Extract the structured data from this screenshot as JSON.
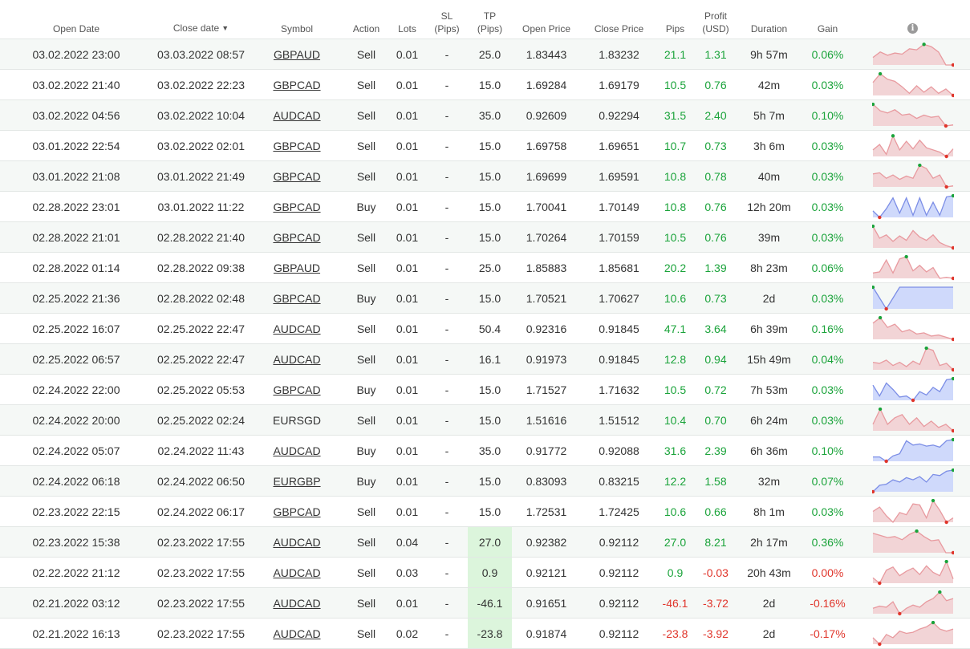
{
  "headers": {
    "open_date": "Open Date",
    "close_date": "Close date",
    "close_sort_icon": "▼",
    "symbol": "Symbol",
    "action": "Action",
    "lots": "Lots",
    "sl_line1": "SL",
    "sl_line2": "(Pips)",
    "tp_line1": "TP",
    "tp_line2": "(Pips)",
    "open_price": "Open Price",
    "close_price": "Close Price",
    "pips": "Pips",
    "profit_line1": "Profit",
    "profit_line2": "(USD)",
    "duration": "Duration",
    "gain": "Gain",
    "info_icon": "i"
  },
  "colors": {
    "positive": "#1aa33a",
    "negative": "#e0352b",
    "sell_fill": "#f2d4d6",
    "sell_stroke": "#e89a9f",
    "buy_fill": "#cfd9fb",
    "buy_stroke": "#7c8ee6",
    "tp_highlight": "#dcf5dc"
  },
  "rows": [
    {
      "open": "03.02.2022 23:00",
      "close": "03.03.2022 08:57",
      "symbol": "GBPAUD",
      "link": true,
      "action": "Sell",
      "lots": "0.01",
      "sl": "-",
      "tp": "25.0",
      "tp_hl": false,
      "open_price": "1.83443",
      "close_price": "1.83232",
      "pips": "21.1",
      "profit": "1.31",
      "duration": "9h 57m",
      "gain": "0.06%",
      "neg": false,
      "spark": [
        0.35,
        0.6,
        0.45,
        0.55,
        0.5,
        0.75,
        0.7,
        0.95,
        0.85,
        0.6,
        0.0,
        0.0
      ]
    },
    {
      "open": "03.02.2022 21:40",
      "close": "03.02.2022 22:23",
      "symbol": "GBPCAD",
      "link": true,
      "action": "Sell",
      "lots": "0.01",
      "sl": "-",
      "tp": "15.0",
      "tp_hl": false,
      "open_price": "1.69284",
      "close_price": "1.69179",
      "pips": "10.5",
      "profit": "0.76",
      "duration": "42m",
      "gain": "0.03%",
      "neg": false,
      "spark": [
        0.6,
        1.0,
        0.75,
        0.65,
        0.4,
        0.1,
        0.45,
        0.15,
        0.4,
        0.1,
        0.3,
        0.0
      ]
    },
    {
      "open": "03.02.2022 04:56",
      "close": "03.02.2022 10:04",
      "symbol": "AUDCAD",
      "link": true,
      "action": "Sell",
      "lots": "0.01",
      "sl": "-",
      "tp": "35.0",
      "tp_hl": false,
      "open_price": "0.92609",
      "close_price": "0.92294",
      "pips": "31.5",
      "profit": "2.40",
      "duration": "5h 7m",
      "gain": "0.10%",
      "neg": false,
      "spark": [
        1.0,
        0.7,
        0.6,
        0.75,
        0.5,
        0.55,
        0.35,
        0.5,
        0.4,
        0.45,
        0.0,
        0.05
      ]
    },
    {
      "open": "03.01.2022 22:54",
      "close": "03.02.2022 02:01",
      "symbol": "GBPCAD",
      "link": true,
      "action": "Sell",
      "lots": "0.01",
      "sl": "-",
      "tp": "15.0",
      "tp_hl": false,
      "open_price": "1.69758",
      "close_price": "1.69651",
      "pips": "10.7",
      "profit": "0.73",
      "duration": "3h 6m",
      "gain": "0.03%",
      "neg": false,
      "spark": [
        0.3,
        0.55,
        0.1,
        0.95,
        0.3,
        0.7,
        0.35,
        0.75,
        0.4,
        0.3,
        0.2,
        0.0,
        0.35
      ]
    },
    {
      "open": "03.01.2022 21:08",
      "close": "03.01.2022 21:49",
      "symbol": "GBPCAD",
      "link": true,
      "action": "Sell",
      "lots": "0.01",
      "sl": "-",
      "tp": "15.0",
      "tp_hl": false,
      "open_price": "1.69699",
      "close_price": "1.69591",
      "pips": "10.8",
      "profit": "0.78",
      "duration": "40m",
      "gain": "0.03%",
      "neg": false,
      "spark": [
        0.6,
        0.65,
        0.4,
        0.55,
        0.35,
        0.5,
        0.4,
        1.0,
        0.85,
        0.4,
        0.55,
        0.0,
        0.05
      ]
    },
    {
      "open": "02.28.2022 23:01",
      "close": "03.01.2022 11:22",
      "symbol": "GBPCAD",
      "link": true,
      "action": "Buy",
      "lots": "0.01",
      "sl": "-",
      "tp": "15.0",
      "tp_hl": false,
      "open_price": "1.70041",
      "close_price": "1.70149",
      "pips": "10.8",
      "profit": "0.76",
      "duration": "12h 20m",
      "gain": "0.03%",
      "neg": false,
      "spark": [
        0.3,
        0.0,
        0.4,
        0.9,
        0.2,
        0.9,
        0.1,
        0.9,
        0.1,
        0.7,
        0.1,
        0.95,
        1.0
      ]
    },
    {
      "open": "02.28.2022 21:01",
      "close": "02.28.2022 21:40",
      "symbol": "GBPCAD",
      "link": true,
      "action": "Sell",
      "lots": "0.01",
      "sl": "-",
      "tp": "15.0",
      "tp_hl": false,
      "open_price": "1.70264",
      "close_price": "1.70159",
      "pips": "10.5",
      "profit": "0.76",
      "duration": "39m",
      "gain": "0.03%",
      "neg": false,
      "spark": [
        1.0,
        0.45,
        0.6,
        0.3,
        0.55,
        0.35,
        0.8,
        0.5,
        0.35,
        0.6,
        0.25,
        0.1,
        0.0
      ]
    },
    {
      "open": "02.28.2022 01:14",
      "close": "02.28.2022 09:38",
      "symbol": "GBPAUD",
      "link": true,
      "action": "Sell",
      "lots": "0.01",
      "sl": "-",
      "tp": "25.0",
      "tp_hl": false,
      "open_price": "1.85883",
      "close_price": "1.85681",
      "pips": "20.2",
      "profit": "1.39",
      "duration": "8h 23m",
      "gain": "0.06%",
      "neg": false,
      "spark": [
        0.25,
        0.3,
        0.85,
        0.25,
        0.9,
        1.0,
        0.35,
        0.6,
        0.3,
        0.5,
        0.0,
        0.05,
        0.0
      ]
    },
    {
      "open": "02.25.2022 21:36",
      "close": "02.28.2022 02:48",
      "symbol": "GBPCAD",
      "link": true,
      "action": "Buy",
      "lots": "0.01",
      "sl": "-",
      "tp": "15.0",
      "tp_hl": false,
      "open_price": "1.70521",
      "close_price": "1.70627",
      "pips": "10.6",
      "profit": "0.73",
      "duration": "2d",
      "gain": "0.03%",
      "neg": false,
      "spark": [
        1.0,
        0.0,
        1.0,
        1.0,
        1.0,
        1.0,
        1.0
      ]
    },
    {
      "open": "02.25.2022 16:07",
      "close": "02.25.2022 22:47",
      "symbol": "AUDCAD",
      "link": true,
      "action": "Sell",
      "lots": "0.01",
      "sl": "-",
      "tp": "50.4",
      "tp_hl": false,
      "open_price": "0.92316",
      "close_price": "0.91845",
      "pips": "47.1",
      "profit": "3.64",
      "duration": "6h 39m",
      "gain": "0.16%",
      "neg": false,
      "spark": [
        0.75,
        1.0,
        0.55,
        0.7,
        0.35,
        0.45,
        0.25,
        0.3,
        0.15,
        0.2,
        0.1,
        0.0
      ]
    },
    {
      "open": "02.25.2022 06:57",
      "close": "02.25.2022 22:47",
      "symbol": "AUDCAD",
      "link": true,
      "action": "Sell",
      "lots": "0.01",
      "sl": "-",
      "tp": "16.1",
      "tp_hl": false,
      "open_price": "0.91973",
      "close_price": "0.91845",
      "pips": "12.8",
      "profit": "0.94",
      "duration": "15h 49m",
      "gain": "0.04%",
      "neg": false,
      "spark": [
        0.35,
        0.3,
        0.45,
        0.2,
        0.35,
        0.15,
        0.4,
        0.25,
        1.0,
        0.9,
        0.2,
        0.3,
        0.0
      ]
    },
    {
      "open": "02.24.2022 22:00",
      "close": "02.25.2022 05:53",
      "symbol": "GBPCAD",
      "link": true,
      "action": "Buy",
      "lots": "0.01",
      "sl": "-",
      "tp": "15.0",
      "tp_hl": false,
      "open_price": "1.71527",
      "close_price": "1.71632",
      "pips": "10.5",
      "profit": "0.72",
      "duration": "7h 53m",
      "gain": "0.03%",
      "neg": false,
      "spark": [
        0.7,
        0.2,
        0.8,
        0.5,
        0.15,
        0.2,
        0.0,
        0.4,
        0.25,
        0.6,
        0.4,
        0.95,
        1.0
      ]
    },
    {
      "open": "02.24.2022 20:00",
      "close": "02.25.2022 02:24",
      "symbol": "EURSGD",
      "link": false,
      "action": "Sell",
      "lots": "0.01",
      "sl": "-",
      "tp": "15.0",
      "tp_hl": false,
      "open_price": "1.51616",
      "close_price": "1.51512",
      "pips": "10.4",
      "profit": "0.70",
      "duration": "6h 24m",
      "gain": "0.03%",
      "neg": false,
      "spark": [
        0.3,
        1.0,
        0.3,
        0.6,
        0.75,
        0.3,
        0.6,
        0.2,
        0.45,
        0.15,
        0.3,
        0.0
      ]
    },
    {
      "open": "02.24.2022 05:07",
      "close": "02.24.2022 11:43",
      "symbol": "AUDCAD",
      "link": true,
      "action": "Buy",
      "lots": "0.01",
      "sl": "-",
      "tp": "35.0",
      "tp_hl": false,
      "open_price": "0.91772",
      "close_price": "0.92088",
      "pips": "31.6",
      "profit": "2.39",
      "duration": "6h 36m",
      "gain": "0.10%",
      "neg": false,
      "spark": [
        0.2,
        0.2,
        0.0,
        0.25,
        0.35,
        0.95,
        0.75,
        0.8,
        0.7,
        0.75,
        0.65,
        0.95,
        1.0
      ]
    },
    {
      "open": "02.24.2022 06:18",
      "close": "02.24.2022 06:50",
      "symbol": "EURGBP",
      "link": true,
      "action": "Buy",
      "lots": "0.01",
      "sl": "-",
      "tp": "15.0",
      "tp_hl": false,
      "open_price": "0.83093",
      "close_price": "0.83215",
      "pips": "12.2",
      "profit": "1.58",
      "duration": "32m",
      "gain": "0.07%",
      "neg": false,
      "spark": [
        0.0,
        0.3,
        0.35,
        0.55,
        0.45,
        0.65,
        0.55,
        0.7,
        0.45,
        0.8,
        0.75,
        0.95,
        1.0
      ]
    },
    {
      "open": "02.23.2022 22:15",
      "close": "02.24.2022 06:17",
      "symbol": "GBPCAD",
      "link": true,
      "action": "Sell",
      "lots": "0.01",
      "sl": "-",
      "tp": "15.0",
      "tp_hl": false,
      "open_price": "1.72531",
      "close_price": "1.72425",
      "pips": "10.6",
      "profit": "0.66",
      "duration": "8h 1m",
      "gain": "0.03%",
      "neg": false,
      "spark": [
        0.5,
        0.7,
        0.3,
        0.0,
        0.45,
        0.35,
        0.85,
        0.8,
        0.2,
        1.0,
        0.55,
        0.0,
        0.2
      ]
    },
    {
      "open": "02.23.2022 15:38",
      "close": "02.23.2022 17:55",
      "symbol": "AUDCAD",
      "link": true,
      "action": "Sell",
      "lots": "0.04",
      "sl": "-",
      "tp": "27.0",
      "tp_hl": true,
      "open_price": "0.92382",
      "close_price": "0.92112",
      "pips": "27.0",
      "profit": "8.21",
      "duration": "2h 17m",
      "gain": "0.36%",
      "neg": false,
      "spark": [
        0.9,
        0.8,
        0.7,
        0.75,
        0.6,
        0.85,
        1.0,
        0.75,
        0.55,
        0.6,
        0.0,
        0.0
      ]
    },
    {
      "open": "02.22.2022 21:12",
      "close": "02.23.2022 17:55",
      "symbol": "AUDCAD",
      "link": true,
      "action": "Sell",
      "lots": "0.03",
      "sl": "-",
      "tp": "0.9",
      "tp_hl": true,
      "open_price": "0.92121",
      "close_price": "0.92112",
      "pips": "0.9",
      "profit": "-0.03",
      "duration": "20h 43m",
      "gain": "0.00%",
      "neg": true,
      "spark": [
        0.25,
        0.0,
        0.6,
        0.75,
        0.35,
        0.55,
        0.7,
        0.4,
        0.8,
        0.5,
        0.35,
        1.0,
        0.2
      ]
    },
    {
      "open": "02.21.2022 03:12",
      "close": "02.23.2022 17:55",
      "symbol": "AUDCAD",
      "link": true,
      "action": "Sell",
      "lots": "0.01",
      "sl": "-",
      "tp": "-46.1",
      "tp_hl": true,
      "open_price": "0.91651",
      "close_price": "0.92112",
      "pips": "-46.1",
      "profit": "-3.72",
      "duration": "2d",
      "gain": "-0.16%",
      "neg": true,
      "spark": [
        0.25,
        0.35,
        0.3,
        0.55,
        0.0,
        0.25,
        0.4,
        0.3,
        0.55,
        0.7,
        1.0,
        0.6,
        0.7
      ]
    },
    {
      "open": "02.21.2022 16:13",
      "close": "02.23.2022 17:55",
      "symbol": "AUDCAD",
      "link": true,
      "action": "Sell",
      "lots": "0.02",
      "sl": "-",
      "tp": "-23.8",
      "tp_hl": true,
      "open_price": "0.91874",
      "close_price": "0.92112",
      "pips": "-23.8",
      "profit": "-3.92",
      "duration": "2d",
      "gain": "-0.17%",
      "neg": true,
      "spark": [
        0.3,
        0.0,
        0.45,
        0.3,
        0.6,
        0.5,
        0.55,
        0.7,
        0.8,
        1.0,
        0.7,
        0.6,
        0.7
      ]
    }
  ]
}
